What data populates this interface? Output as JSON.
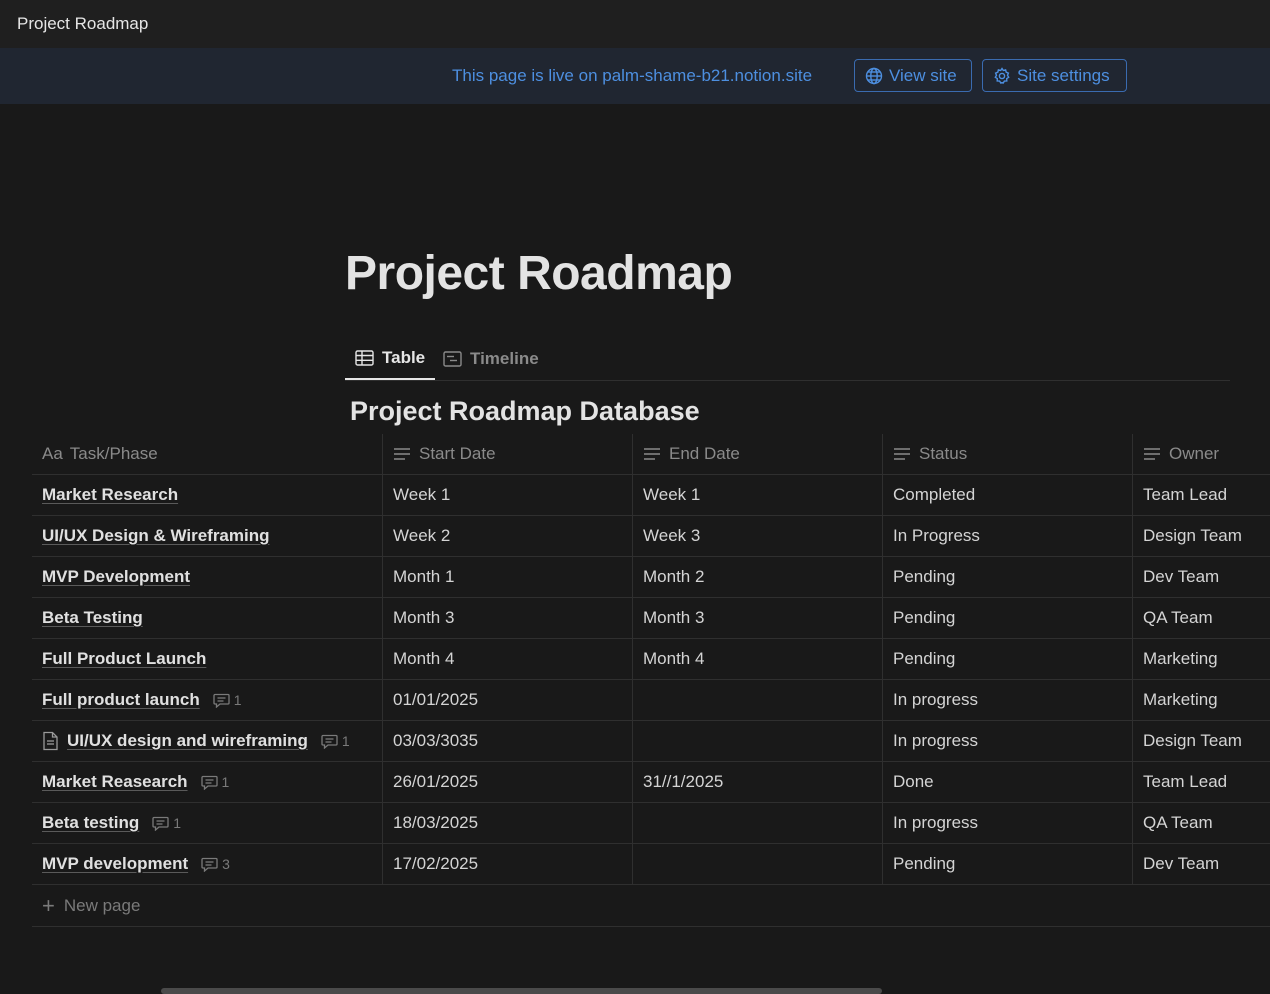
{
  "window": {
    "title": "Project Roadmap"
  },
  "banner": {
    "live_text": "This page is live on palm-shame-b21.notion.site",
    "view_site": "View site",
    "site_settings": "Site settings"
  },
  "page": {
    "title": "Project Roadmap"
  },
  "tabs": [
    {
      "label": "Table",
      "icon": "table-icon",
      "active": true
    },
    {
      "label": "Timeline",
      "icon": "timeline-icon",
      "active": false
    }
  ],
  "database": {
    "title": "Project Roadmap Database",
    "columns": {
      "task_prefix": "Aa",
      "task": "Task/Phase",
      "start": "Start Date",
      "end": "End Date",
      "status": "Status",
      "owner": "Owner"
    },
    "rows": [
      {
        "task": "Market Research",
        "start": "Week 1",
        "end": "Week 1",
        "status": "Completed",
        "owner": "Team Lead",
        "comments": ""
      },
      {
        "task": "UI/UX Design & Wireframing",
        "start": "Week 2",
        "end": "Week 3",
        "status": "In Progress",
        "owner": "Design Team",
        "comments": ""
      },
      {
        "task": "MVP Development",
        "start": "Month 1",
        "end": "Month 2",
        "status": "Pending",
        "owner": "Dev Team",
        "comments": ""
      },
      {
        "task": "Beta Testing",
        "start": "Month 3",
        "end": "Month 3",
        "status": "Pending",
        "owner": "QA Team",
        "comments": ""
      },
      {
        "task": "Full Product Launch",
        "start": "Month 4",
        "end": "Month 4",
        "status": "Pending",
        "owner": "Marketing",
        "comments": ""
      },
      {
        "task": "Full product launch",
        "start": "01/01/2025",
        "end": "",
        "status": "In progress",
        "owner": "Marketing",
        "comments": "1"
      },
      {
        "task": "UI/UX design and wireframing",
        "start": "03/03/3035",
        "end": "",
        "status": "In progress",
        "owner": "Design Team",
        "comments": "1",
        "doc_icon": true
      },
      {
        "task": "Market Reasearch",
        "start": "26/01/2025",
        "end": "31//1/2025",
        "status": "Done",
        "owner": "Team Lead",
        "comments": "1"
      },
      {
        "task": "Beta testing",
        "start": "18/03/2025",
        "end": "",
        "status": "In progress",
        "owner": "QA Team",
        "comments": "1"
      },
      {
        "task": "MVP development",
        "start": "17/02/2025",
        "end": "",
        "status": "Pending",
        "owner": "Dev Team",
        "comments": "3"
      }
    ],
    "new_page": "New page"
  }
}
